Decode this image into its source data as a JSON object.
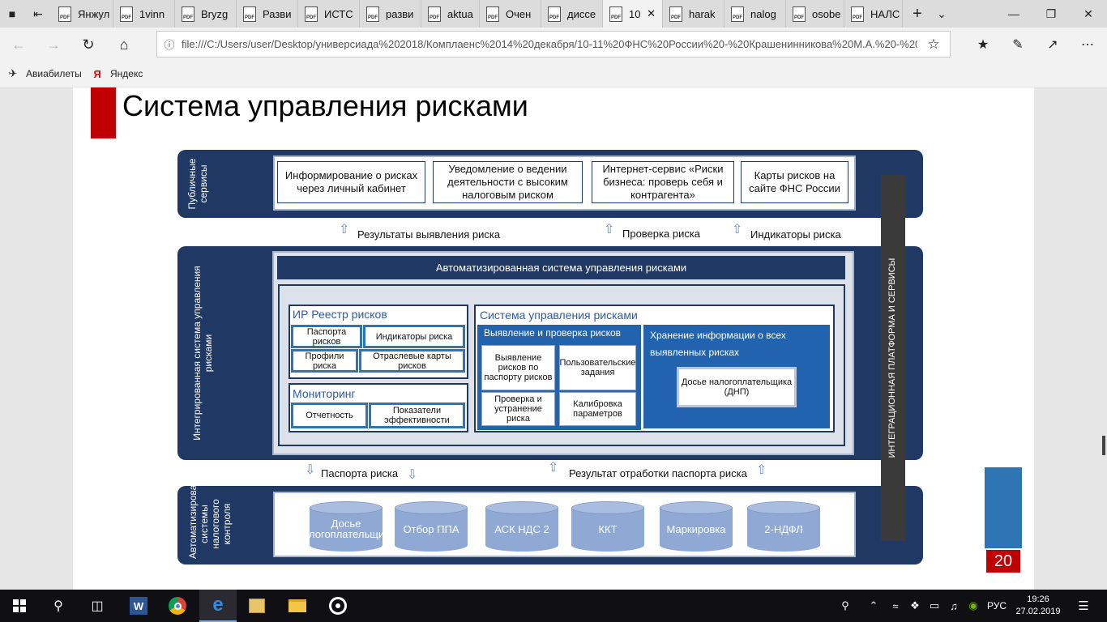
{
  "tabs": [
    {
      "label": "Янжул",
      "active": false
    },
    {
      "label": "1vinn",
      "active": false
    },
    {
      "label": "Bryzg",
      "active": false
    },
    {
      "label": "Разви",
      "active": false
    },
    {
      "label": "ИСТС",
      "active": false
    },
    {
      "label": "разви",
      "active": false
    },
    {
      "label": "aktua",
      "active": false
    },
    {
      "label": "Очен",
      "active": false
    },
    {
      "label": "диссе",
      "active": false
    },
    {
      "label": "10",
      "active": true
    },
    {
      "label": "harak",
      "active": false
    },
    {
      "label": "nalog",
      "active": false
    },
    {
      "label": "osobe",
      "active": false
    },
    {
      "label": "НАЛС",
      "active": false
    }
  ],
  "address": {
    "url": "file:///C:/Users/user/Desktop/универсиада%202018/Комплаенс%2014%20декабря/10-11%20ФНС%20России%20-%20Крашенинникова%20М.А.%20-%20"
  },
  "favorites": [
    {
      "label": "Авиабилеты",
      "icon": "plane-icon"
    },
    {
      "label": "Яндекс",
      "icon": "yandex-icon"
    }
  ],
  "slide": {
    "title": "Система управления рисками",
    "public_label": "Публичные сервисы",
    "public_services": [
      "Информирование о рисках через личный кабинет",
      "Уведомление о ведении деятельности с высоким налоговым риском",
      "Интернет-сервис «Риски бизнеса: проверь себя и контрагента»",
      "Карты рисков на сайте ФНС России"
    ],
    "arrows_top": [
      "Результаты выявления риска",
      "Проверка риска",
      "Индикаторы риска"
    ],
    "integrated_label": "Интегрированная система управления рисками",
    "asur_title": "Автоматизированная система управления рисками",
    "registry": {
      "title": "ИР Реестр рисков",
      "cells": [
        "Паспорта рисков",
        "Индикаторы риска",
        "Профили риска",
        "Отраслевые карты рисков"
      ]
    },
    "monitoring": {
      "title": "Мониторинг",
      "cells": [
        "Отчетность",
        "Показатели эффективности"
      ]
    },
    "risk_system": {
      "title": "Система управления рисками",
      "detect_title": "Выявление и проверка рисков",
      "detect_cells": [
        "Выявление рисков по паспорту рисков",
        "Пользовательские задания",
        "Проверка и устранение риска",
        "Калибровка параметров"
      ],
      "storage_title": "Хранение информации о всех выявленных рисках",
      "dossier": "Досье налогоплательщика (ДНП)"
    },
    "arrows_bottom": [
      "Паспорта риска",
      "Результат отработки паспорта риска"
    ],
    "auto_label": "Автоматизированные системы налогового контроля",
    "databases": [
      "Досье налогоплательщика",
      "Отбор ППА",
      "АСК НДС 2",
      "ККТ",
      "Маркировка",
      "2-НДФЛ"
    ],
    "platform_label": "ИНТЕГРАЦИОННАЯ ПЛАТФОРМА И СЕРВИСЫ",
    "page_number": "20"
  },
  "taskbar": {
    "apps": [
      "start-icon",
      "search-icon",
      "task-view-icon",
      "word-icon",
      "chrome-icon",
      "edge-icon",
      "file-manager-icon",
      "explorer-icon",
      "media-icon"
    ],
    "language": "РУС",
    "time": "19:26",
    "date": "27.02.2019"
  },
  "colors": {
    "navy": "#1f3864",
    "accent_blue": "#2e75b6",
    "accent_red": "#c00000",
    "db_blue": "#8fa9d4"
  }
}
